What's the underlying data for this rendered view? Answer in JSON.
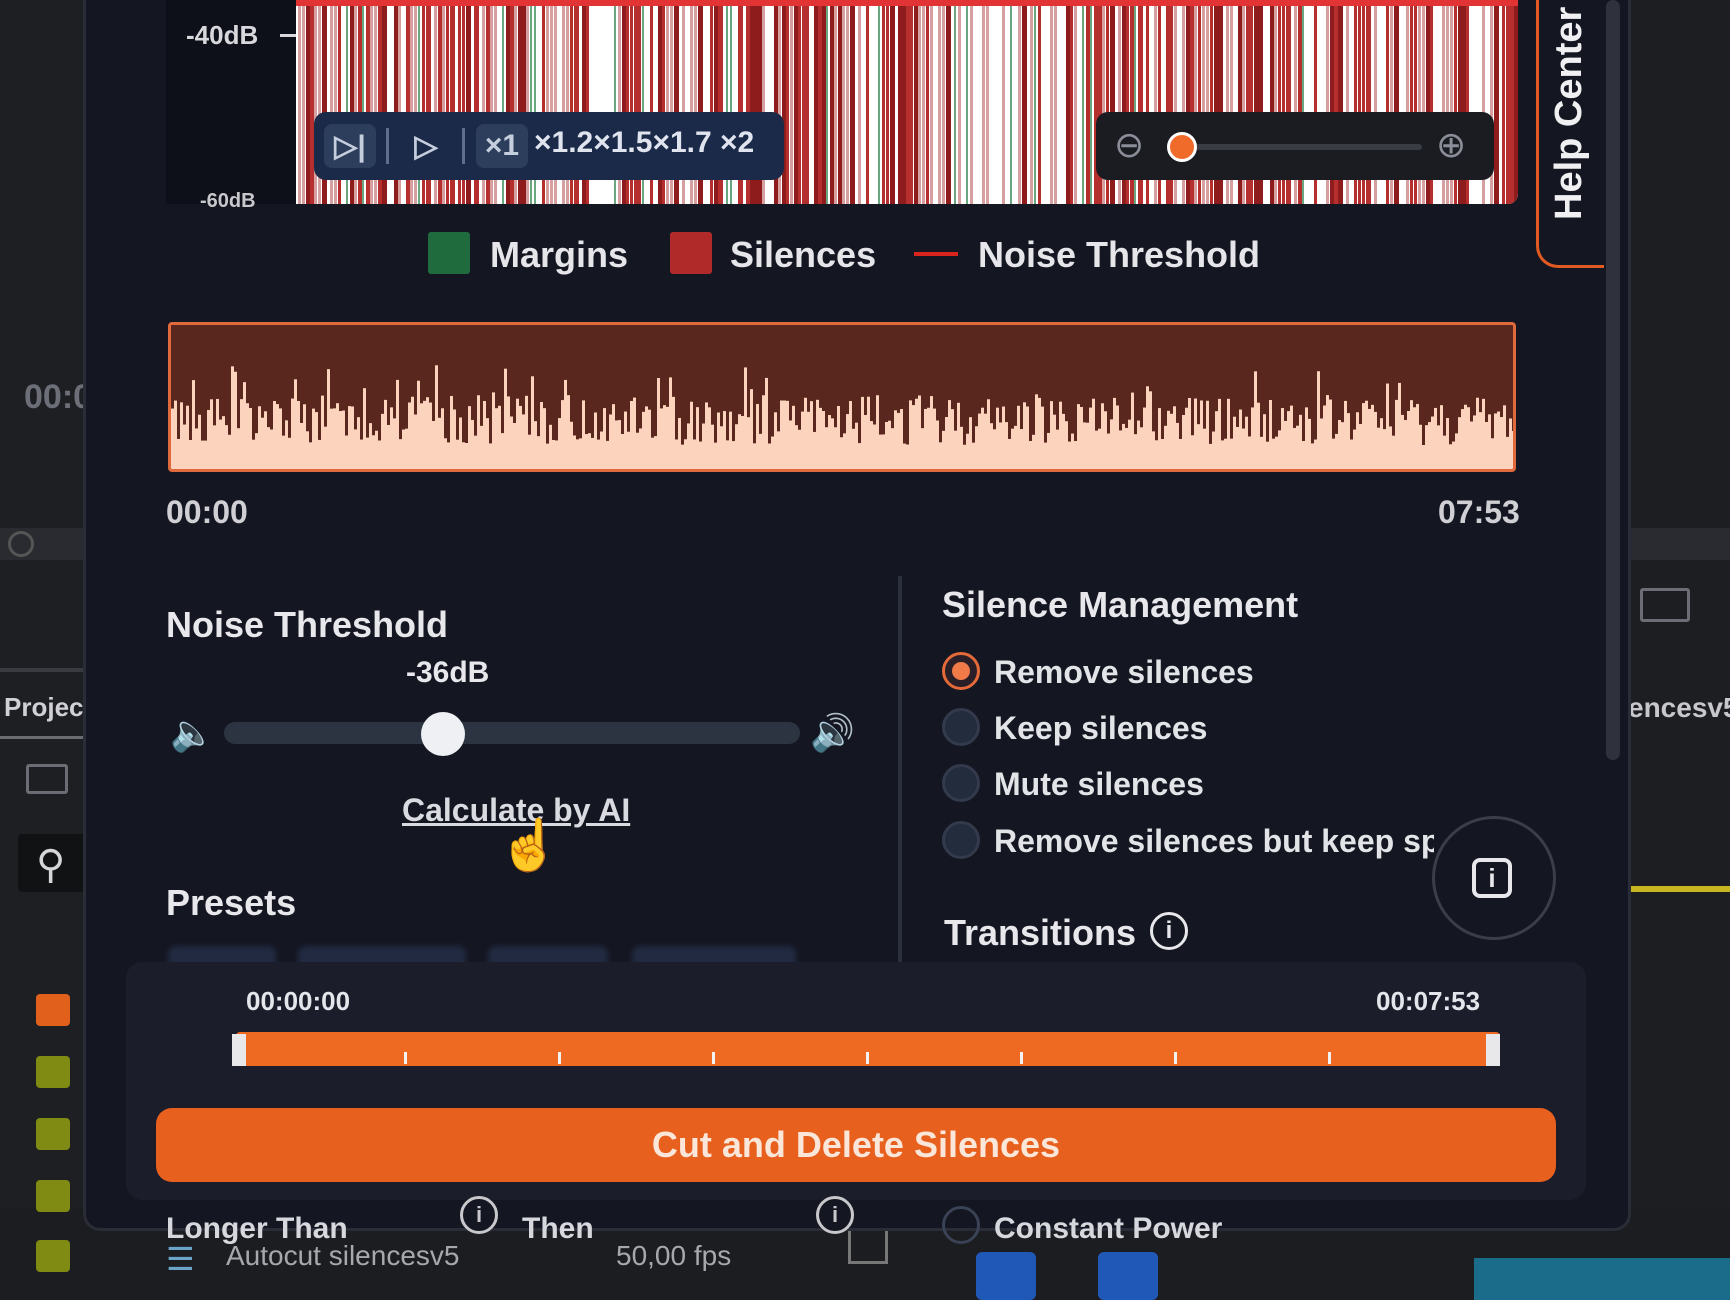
{
  "background_app": {
    "timecode": "00:0",
    "project_tab": "Projec",
    "right_clip_label": "encesv5",
    "clip_name": "Autocut silencesv5",
    "clip_fps": "50,00 fps",
    "swatch_colors": [
      "#e0601c",
      "#7f8b12",
      "#7f8b12",
      "#7f8b12",
      "#7f8b12"
    ]
  },
  "waveform": {
    "db_top": "-40dB",
    "db_bottom": "-60dB",
    "speeds": "×1.2×1.5×1.7 ×2",
    "speed_selected": "×1",
    "zoom_level": 0.04
  },
  "help_center": {
    "label": "Help Center"
  },
  "legend": [
    {
      "label": "Margins",
      "color": "#1f6b3e"
    },
    {
      "label": "Silences",
      "color": "#b02a2a"
    },
    {
      "label": "Noise Threshold",
      "color": "#d8231f"
    }
  ],
  "timeline": {
    "start": "00:00",
    "end": "07:53"
  },
  "noise_threshold": {
    "title": "Noise Threshold",
    "value_label": "-36dB",
    "slider_fraction": 0.38,
    "calc_label": "Calculate by AI"
  },
  "presets": {
    "title": "Presets"
  },
  "silence_management": {
    "title": "Silence Management",
    "options": [
      {
        "label": "Remove silences",
        "selected": true
      },
      {
        "label": "Keep silences",
        "selected": false
      },
      {
        "label": "Mute silences",
        "selected": false
      },
      {
        "label": "Remove silences but keep spa",
        "selected": false
      }
    ]
  },
  "transitions": {
    "title": "Transitions"
  },
  "range": {
    "start": "00:00:00",
    "end": "00:07:53"
  },
  "action": {
    "label": "Cut and Delete Silences"
  },
  "under_overlay": {
    "longer_than": "Longer Than",
    "then_fragment": "Then",
    "constant_power": "Constant Power"
  },
  "colors": {
    "accent": "#ee6a22",
    "panel_bg": "#141621"
  }
}
